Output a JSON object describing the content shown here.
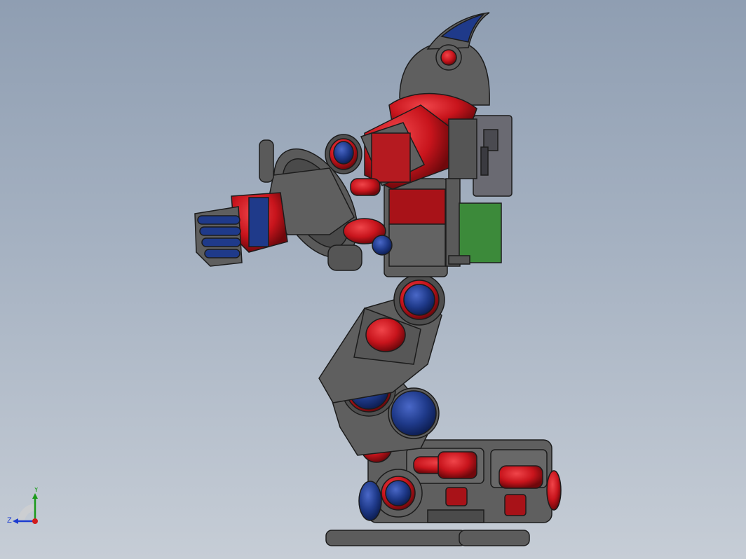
{
  "viewport": {
    "background_top": "#8f9eb2",
    "background_bottom": "#c6cdd6"
  },
  "model": {
    "body_gray": "#5f5f5f",
    "accent_red": "#c8141c",
    "accent_blue": "#1f3a8a",
    "board_green": "#3c8a3a",
    "outline": "#1c1c1c"
  },
  "triad": {
    "y_label": "Y",
    "z_label": "Z",
    "x_color": "#d21c1c",
    "y_color": "#1a9a1a",
    "z_color": "#1c3cd0"
  }
}
